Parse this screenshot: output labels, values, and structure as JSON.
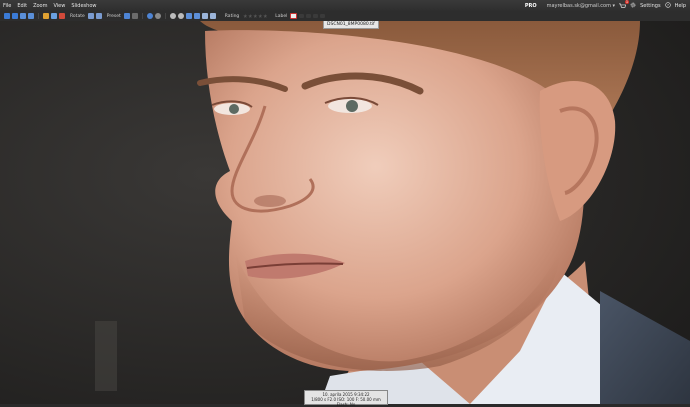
{
  "menu": {
    "items": [
      "File",
      "Edit",
      "Zoom",
      "View",
      "Slideshow"
    ]
  },
  "account": {
    "pro_label": "PRO",
    "email": "mayrelbas.sk@gmail.com ▾",
    "notification_count": "1",
    "settings_label": "Settings",
    "help_label": "Help"
  },
  "toolbar": {
    "rotate_label": "Rotate",
    "preset_label": "Preset",
    "rating_label": "Rating",
    "label_label": "Label",
    "accent": "#3b7bd6",
    "rating": 0
  },
  "photo": {
    "filename": "DSCN01_8MP0080.tif"
  },
  "info": {
    "date": "10. apríla 2015 9:34:22",
    "exif": "1/800 s F2.0 ISO: 100 F: 50.00 mm Flash: No"
  }
}
